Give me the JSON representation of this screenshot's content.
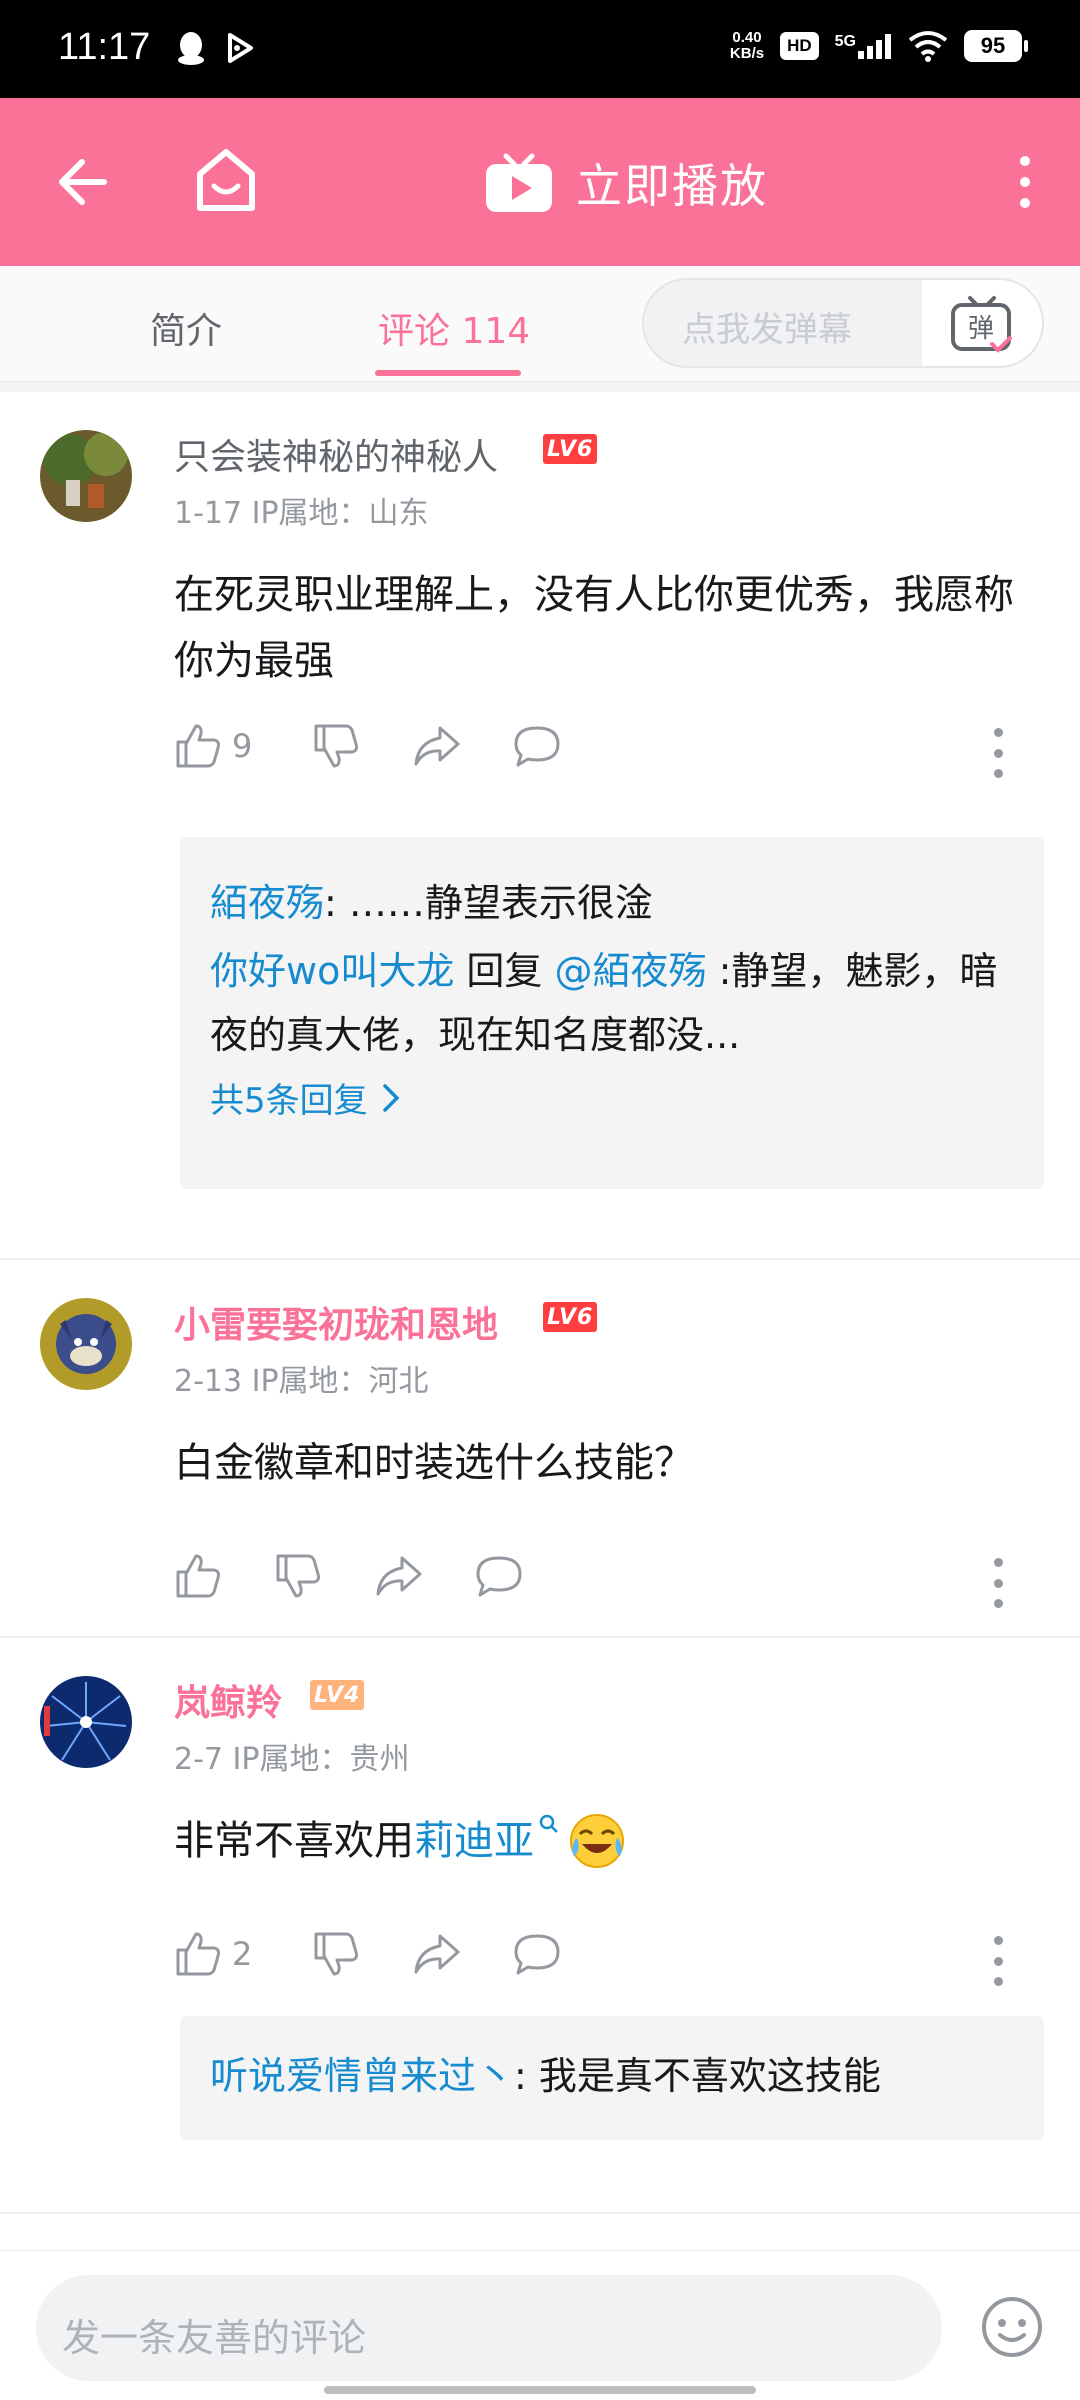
{
  "status_bar": {
    "time": "11:17",
    "net_speed_value": "0.40",
    "net_speed_unit": "KB/s",
    "hd": "HD",
    "signal": "5G",
    "battery": "95"
  },
  "header": {
    "play_label": "立即播放"
  },
  "tabs": {
    "intro": "简介",
    "comments": "评论 114",
    "danmu_placeholder": "点我发弹幕",
    "danmu_button": "弹"
  },
  "comments": [
    {
      "username": "只会装神秘的神秘人",
      "level": "LV6",
      "meta": "1-17  IP属地：山东",
      "text": "在死灵职业理解上，没有人比你更优秀，我愿称你为最强",
      "likes": "9",
      "replies": {
        "r1_user": "絔夜殇",
        "r1_text": ": ……静望表示很淦",
        "r2_user": "你好wo叫大龙",
        "r2_mid": " 回复 ",
        "r2_at": "@絔夜殇",
        "r2_text": " :静望，魅影，暗夜的真大佬，现在知名度都没...",
        "more": "共5条回复"
      }
    },
    {
      "username": "小雷要娶初珑和恩地",
      "level": "LV6",
      "meta": "2-13  IP属地：河北",
      "text": "白金徽章和时装选什么技能？"
    },
    {
      "username": "岚鲸羚",
      "level": "LV4",
      "meta": "2-7  IP属地：贵州",
      "text_before": "非常不喜欢用",
      "text_link": "莉迪亚",
      "likes": "2",
      "replies": {
        "r1_user": "听说爱情曾来过丶",
        "r1_text": ": 我是真不喜欢这技能"
      }
    }
  ],
  "bottom": {
    "placeholder": "发一条友善的评论"
  },
  "colors": {
    "brand_pink": "#fb7299",
    "link_blue": "#178bcf",
    "lv6": "#ff3f3f",
    "lv4": "#ffb37c"
  }
}
